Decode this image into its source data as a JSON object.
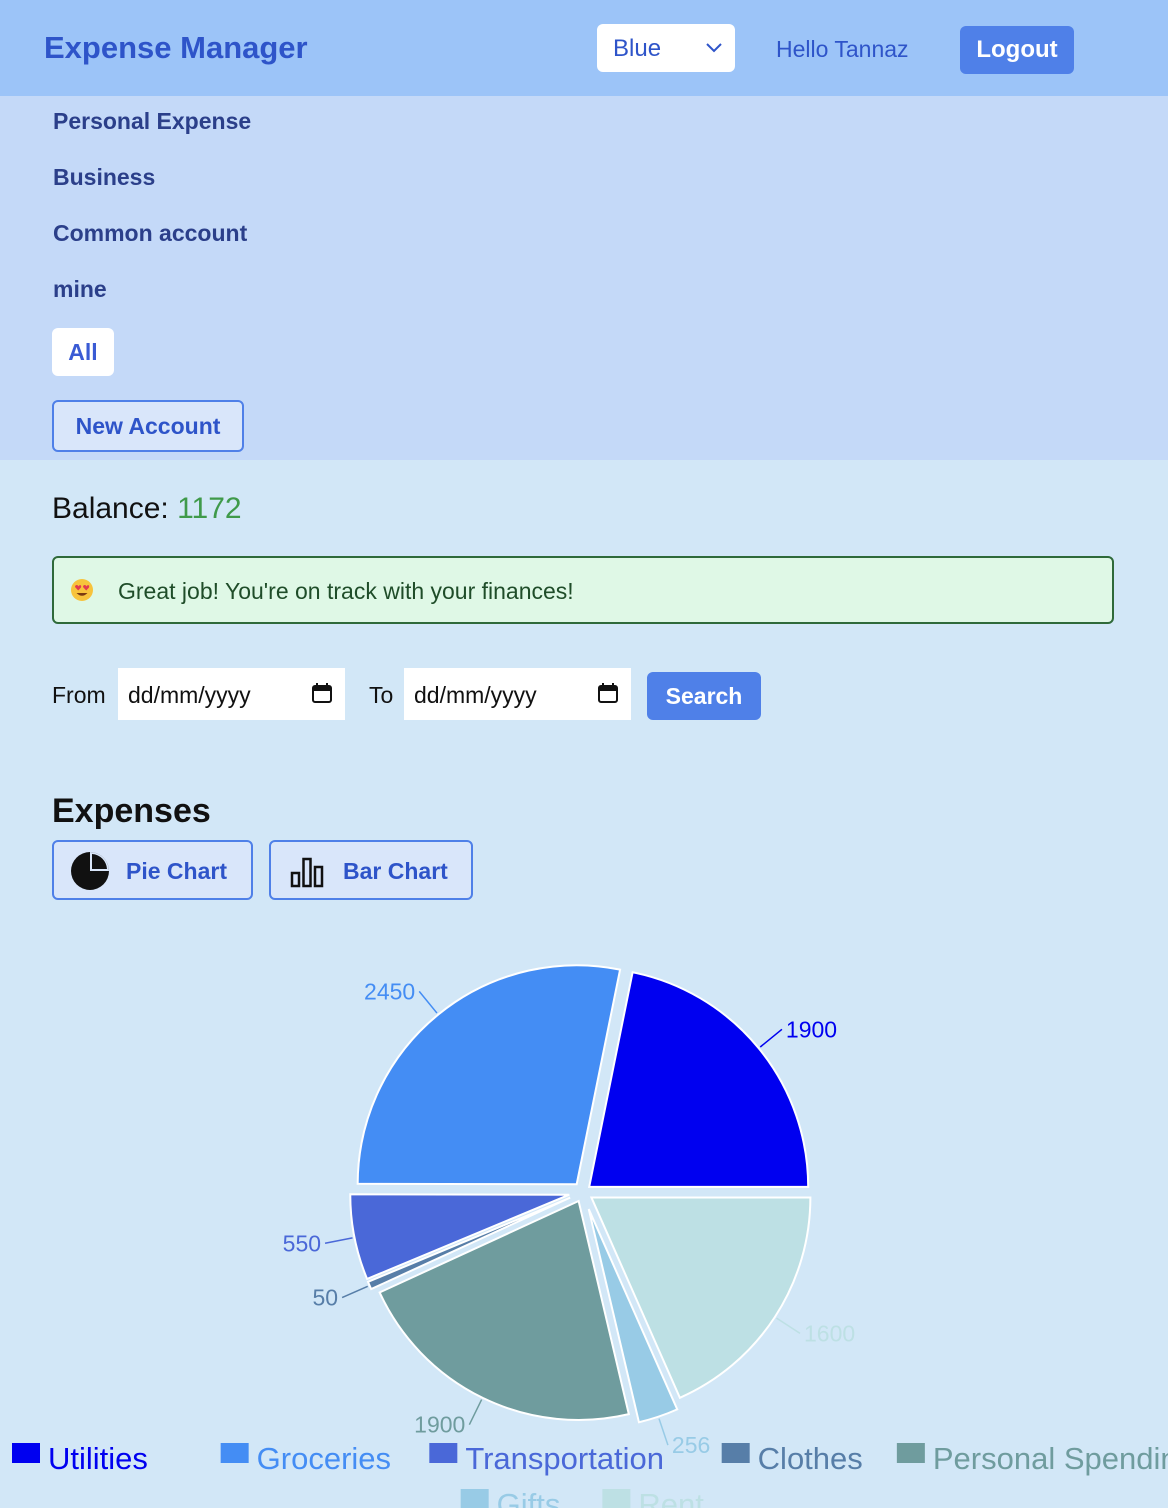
{
  "header": {
    "brand": "Expense Manager",
    "theme_selected": "Blue",
    "greeting": "Hello Tannaz",
    "logout_label": "Logout"
  },
  "accounts": {
    "items": [
      "Personal Expense",
      "Business",
      "Common account",
      "mine"
    ],
    "all_label": "All",
    "new_account_label": "New Account"
  },
  "balance": {
    "label": "Balance:",
    "amount": "1172"
  },
  "alert": {
    "emoji": "heart-eyes-emoji",
    "message": "Great job! You're on track with your finances!"
  },
  "filter": {
    "from_label": "From",
    "to_label": "To",
    "from_placeholder": "dd/mm/yyyy",
    "to_placeholder": "dd/mm/yyyy",
    "search_label": "Search"
  },
  "expenses": {
    "title": "Expenses",
    "pie_button": "Pie Chart",
    "bar_button": "Bar Chart"
  },
  "colors": {
    "accent": "#4f80e8",
    "brand": "#2e54c9",
    "positive": "#3f9a4a"
  },
  "chart_data": {
    "type": "pie",
    "categories": [
      "Utilities",
      "Groceries",
      "Transportation",
      "Clothes",
      "Personal Spendings",
      "Gifts",
      "Rent"
    ],
    "values": [
      1900,
      2450,
      550,
      50,
      1900,
      256,
      1600
    ],
    "slice_order_from_3_oclock_counterclockwise": [
      "Utilities",
      "Groceries",
      "Transportation",
      "Clothes",
      "Personal Spendings",
      "Gifts",
      "Rent"
    ],
    "colors": [
      "#0000f0",
      "#448df4",
      "#4a68d8",
      "#577ea8",
      "#6f9c9e",
      "#98cbe6",
      "#bde0e4"
    ],
    "legend": "bottom",
    "data_labels": true,
    "exploded_slices": true
  }
}
